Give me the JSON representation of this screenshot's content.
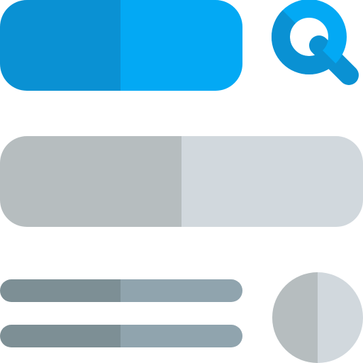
{
  "colors": {
    "search_pill_left": "#0A91D3",
    "search_pill_right": "#03A9F4",
    "search_icon_dark": "#0A91D3",
    "search_icon_light": "#03A9F4",
    "big_bar_left": "#B6BDBF",
    "big_bar_right": "#D1D8DD",
    "line_left": "#7D8F95",
    "line_right": "#90A4AE",
    "circle_left": "#B6BDBF",
    "circle_right": "#D1D8DD"
  },
  "icons": {
    "search": "search-icon",
    "circle": "circle-icon"
  }
}
